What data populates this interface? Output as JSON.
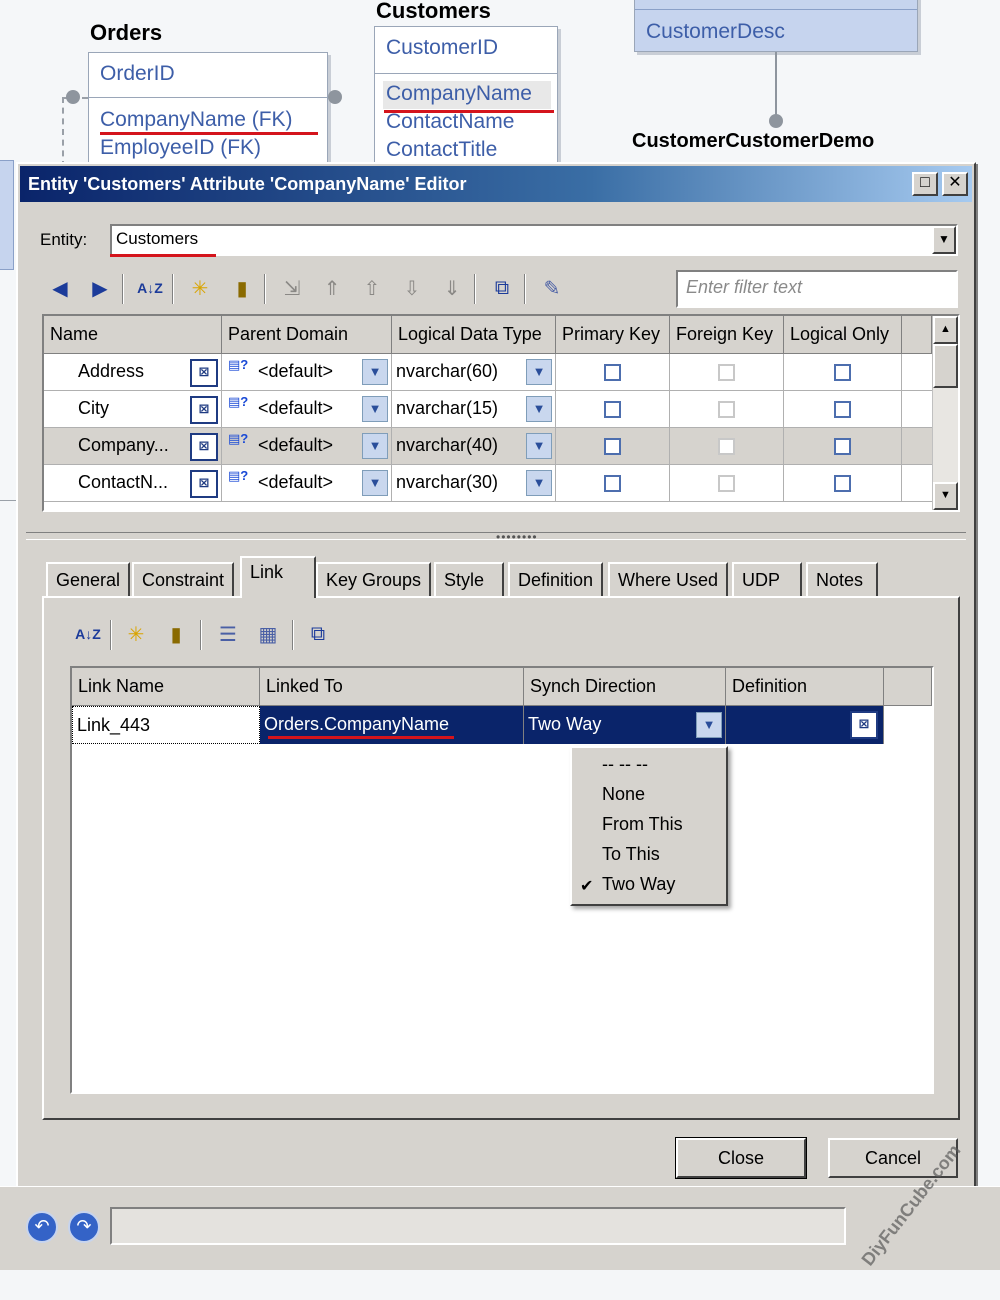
{
  "diagram": {
    "orders": {
      "title": "Orders",
      "pk": "OrderID",
      "fk1": "CompanyName (FK)",
      "fk2": "EmployeeID (FK)"
    },
    "customers": {
      "title": "Customers",
      "pk": "CustomerID",
      "attr1": "CompanyName",
      "attr2": "ContactName",
      "attr3": "ContactTitle"
    },
    "demographics": {
      "attr": "CustomerDesc"
    },
    "ccd_title": "CustomerCustomerDemo"
  },
  "dialog": {
    "title": "Entity 'Customers' Attribute 'CompanyName' Editor",
    "entity_label": "Entity:",
    "entity_value": "Customers",
    "filter_placeholder": "Enter filter text",
    "columns": [
      "Name",
      "Parent Domain",
      "Logical Data Type",
      "Primary Key",
      "Foreign Key",
      "Logical Only"
    ],
    "rows": [
      {
        "name": "Address",
        "domain": "<default>",
        "type": "nvarchar(60)"
      },
      {
        "name": "City",
        "domain": "<default>",
        "type": "nvarchar(15)"
      },
      {
        "name": "Company...",
        "domain": "<default>",
        "type": "nvarchar(40)"
      },
      {
        "name": "ContactN...",
        "domain": "<default>",
        "type": "nvarchar(30)"
      }
    ],
    "tabs": [
      "General",
      "Constraint",
      "Link",
      "Key Groups",
      "Style",
      "Definition",
      "Where Used",
      "UDP",
      "Notes"
    ],
    "link_columns": [
      "Link Name",
      "Linked To",
      "Synch Direction",
      "Definition"
    ],
    "link_row": {
      "name": "Link_443",
      "linked_to": "Orders.CompanyName",
      "direction": "Two Way",
      "definition": ""
    },
    "menu": [
      "-- -- --",
      "None",
      "From This",
      "To This",
      "Two Way"
    ],
    "menu_checked": "Two Way",
    "close_label": "Close",
    "cancel_label": "Cancel"
  },
  "watermark": "DiyFunCube.com",
  "colors": {
    "title_start": "#0a246a",
    "title_end": "#a6caf0",
    "selection": "#0a246a",
    "red_underline": "#d4141c",
    "link_blue": "#3d5ea8"
  }
}
